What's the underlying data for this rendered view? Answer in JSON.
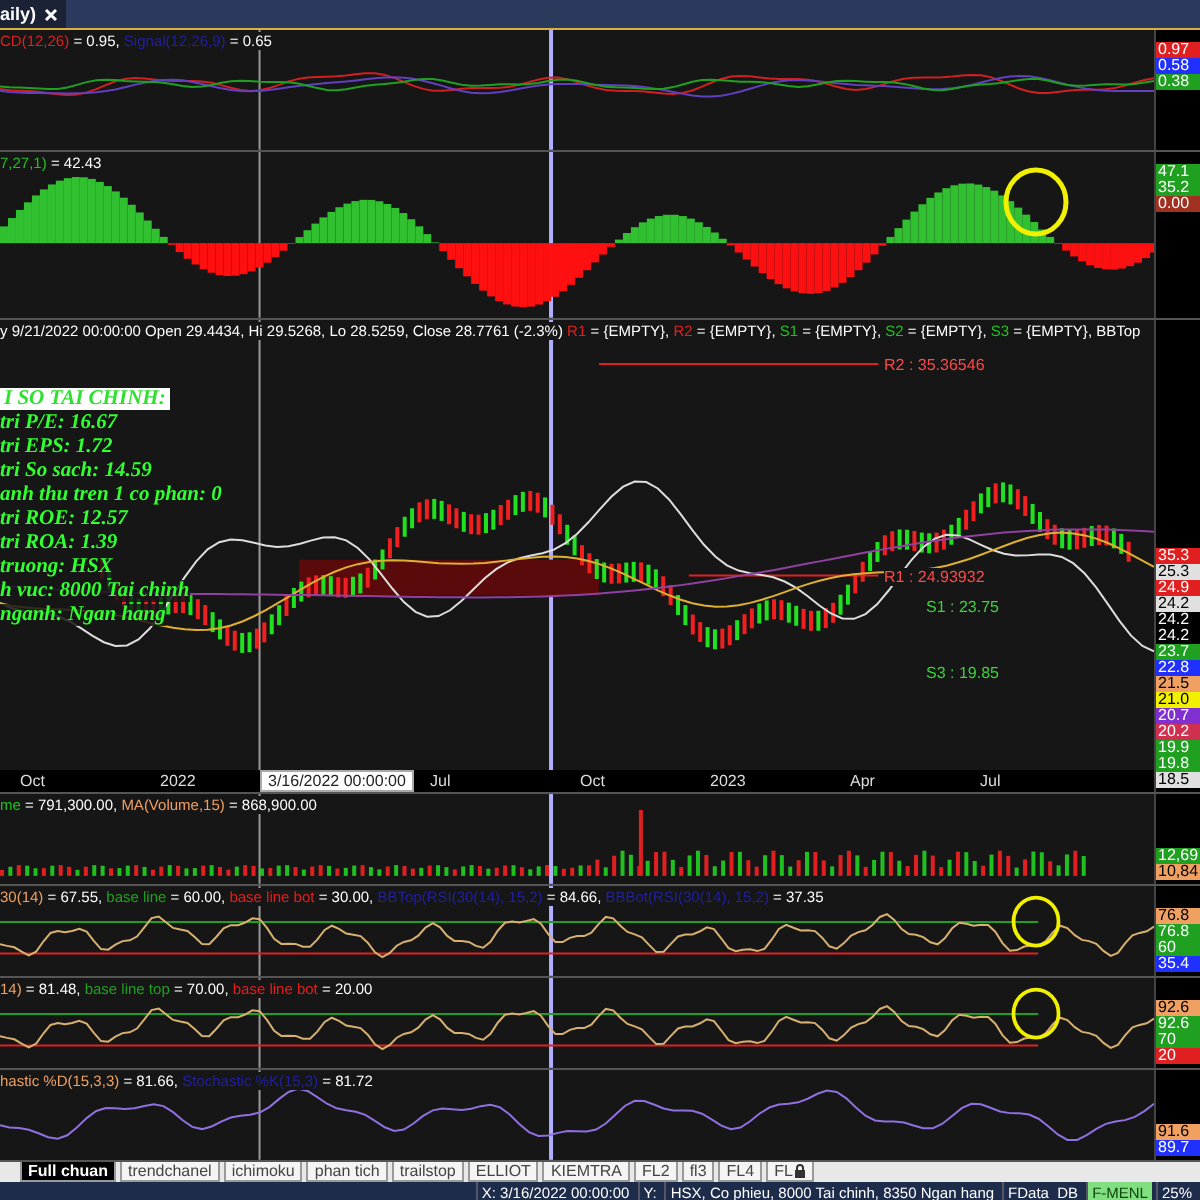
{
  "top_tab": {
    "title": "aily)"
  },
  "panes": [
    {
      "kind": "macd",
      "annotation": false,
      "legend": [
        {
          "text": "CD(12,26)",
          "color": "#e02020"
        },
        {
          "text": " = 0.95, ",
          "color": "#ffffff"
        },
        {
          "text": "Signal(12,26,9)",
          "color": "#2020a0"
        },
        {
          "text": " = 0.65",
          "color": "#ffffff"
        }
      ],
      "axis": [
        {
          "text": "0.97",
          "color": "#e02020"
        },
        {
          "text": "0.58",
          "color": "#2030ff"
        },
        {
          "text": "0.38",
          "color": "#20a020"
        }
      ]
    },
    {
      "kind": "oscillator",
      "annotation": true,
      "legend": [
        {
          "text": "7,27,1)",
          "color": "#20c020"
        },
        {
          "text": " = 42.43",
          "color": "#ffffff"
        }
      ],
      "axis": [
        {
          "text": "47.1",
          "color": "#20a020"
        },
        {
          "text": "35.2",
          "color": "#20a020"
        },
        {
          "text": "0.00",
          "color": "#a03020"
        }
      ]
    },
    {
      "kind": "price",
      "annotation": false,
      "legend": [
        {
          "text": "y 9/21/2022 00:00:00 Open 29.4434, Hi 29.5268, Lo 28.5259, Close 28.7761 (-2.3%) ",
          "color": "#ffffff"
        },
        {
          "text": "R1",
          "color": "#e02020"
        },
        {
          "text": " = {EMPTY}, ",
          "color": "#ffffff"
        },
        {
          "text": "R2",
          "color": "#e02020"
        },
        {
          "text": " = {EMPTY}, ",
          "color": "#ffffff"
        },
        {
          "text": "S1",
          "color": "#20c020"
        },
        {
          "text": " = {EMPTY}, ",
          "color": "#ffffff"
        },
        {
          "text": "S2",
          "color": "#20c020"
        },
        {
          "text": " = {EMPTY}, ",
          "color": "#ffffff"
        },
        {
          "text": "S3",
          "color": "#20c020"
        },
        {
          "text": " = {EMPTY}, BBTop",
          "color": "#ffffff"
        }
      ],
      "axis": [
        {
          "text": "35.3",
          "color": "#e02020"
        },
        {
          "text": "25.3",
          "color": "#e0e0e0"
        },
        {
          "text": "24.9",
          "color": "#e02020"
        },
        {
          "text": "24.2",
          "color": "#e0e0e0"
        },
        {
          "text": "24.2",
          "color": "#000000"
        },
        {
          "text": "24.2",
          "color": "#000000"
        },
        {
          "text": "23.7",
          "color": "#20a020"
        },
        {
          "text": "22.8",
          "color": "#2030ff"
        },
        {
          "text": "21.5",
          "color": "#f0a060"
        },
        {
          "text": "21.0",
          "color": "#f0f000"
        },
        {
          "text": "20.7",
          "color": "#8030d0"
        },
        {
          "text": "20.2",
          "color": "#d03050"
        },
        {
          "text": "19.9",
          "color": "#20a020"
        },
        {
          "text": "19.8",
          "color": "#20a020"
        },
        {
          "text": "18.5",
          "color": "#e0e0e0"
        }
      ],
      "info_title": "I SO TAI CHINH:",
      "info_lines": [
        "tri P/E: 16.67",
        "tri EPS: 1.72",
        "tri So sach: 14.59",
        "anh thu tren 1 co phan: 0",
        "tri ROE: 12.57",
        "tri ROA: 1.39",
        "truong: HSX",
        "h vuc: 8000 Tai chinh",
        "nganh: Ngan hang"
      ],
      "levels": [
        {
          "text": "R2 : 35.36546",
          "kind": "resistance"
        },
        {
          "text": "R1 : 24.93932",
          "kind": "resistance"
        },
        {
          "text": "S1 : 23.75",
          "kind": "support"
        },
        {
          "text": "S3 : 19.85",
          "kind": "support"
        }
      ],
      "dates": [
        "Oct",
        "2022",
        "Jul",
        "Oct",
        "2023",
        "Apr",
        "Jul"
      ],
      "cursor_date": "3/16/2022 00:00:00"
    },
    {
      "kind": "volume",
      "annotation": false,
      "legend": [
        {
          "text": "me",
          "color": "#20c020"
        },
        {
          "text": " = 791,300.00, ",
          "color": "#ffffff"
        },
        {
          "text": "MA(Volume,15)",
          "color": "#f0a060"
        },
        {
          "text": " = 868,900.00",
          "color": "#ffffff"
        }
      ],
      "axis": [
        {
          "text": "12,69",
          "color": "#20a020"
        },
        {
          "text": "10,84",
          "color": "#f0a060"
        }
      ]
    },
    {
      "kind": "rsi",
      "annotation": true,
      "legend": [
        {
          "text": "30(14)",
          "color": "#f0a060"
        },
        {
          "text": " = 67.55, ",
          "color": "#ffffff"
        },
        {
          "text": "base line",
          "color": "#20a020"
        },
        {
          "text": " = 60.00, ",
          "color": "#ffffff"
        },
        {
          "text": "base line bot",
          "color": "#e02020"
        },
        {
          "text": " = 30.00, ",
          "color": "#ffffff"
        },
        {
          "text": "BBTop(RSI(30(14), 15,2)",
          "color": "#2020a0"
        },
        {
          "text": " = 84.66, ",
          "color": "#ffffff"
        },
        {
          "text": "BBBot(RSI(30(14), 15,2)",
          "color": "#2020a0"
        },
        {
          "text": " = 37.35",
          "color": "#ffffff"
        }
      ],
      "axis": [
        {
          "text": "76.8",
          "color": "#f0a060"
        },
        {
          "text": "76.8",
          "color": "#20a020"
        },
        {
          "text": "60",
          "color": "#20a020"
        },
        {
          "text": "35.4",
          "color": "#2030ff"
        }
      ]
    },
    {
      "kind": "rsi",
      "annotation": true,
      "legend": [
        {
          "text": "14)",
          "color": "#f0a060"
        },
        {
          "text": " = 81.48, ",
          "color": "#ffffff"
        },
        {
          "text": "base line top",
          "color": "#20a020"
        },
        {
          "text": " = 70.00, ",
          "color": "#ffffff"
        },
        {
          "text": "base line bot",
          "color": "#e02020"
        },
        {
          "text": " = 20.00",
          "color": "#ffffff"
        }
      ],
      "axis": [
        {
          "text": "92.6",
          "color": "#f0a060"
        },
        {
          "text": "92.6",
          "color": "#20a020"
        },
        {
          "text": "70",
          "color": "#20a020"
        },
        {
          "text": "20",
          "color": "#e02020"
        }
      ]
    },
    {
      "kind": "stochastic",
      "annotation": false,
      "legend": [
        {
          "text": "hastic %D(15,3,3)",
          "color": "#f0a060"
        },
        {
          "text": " = 81.66, ",
          "color": "#ffffff"
        },
        {
          "text": "Stochastic %K(15,3)",
          "color": "#2020a0"
        },
        {
          "text": " = 81.72",
          "color": "#ffffff"
        }
      ],
      "axis": [
        {
          "text": "91.6",
          "color": "#f0a060"
        },
        {
          "text": "89.7",
          "color": "#2030ff"
        }
      ]
    }
  ],
  "sheet_tabs": [
    {
      "label": "Full chuan",
      "selected": true,
      "locked": false
    },
    {
      "label": "trendchanel",
      "selected": false,
      "locked": false
    },
    {
      "label": "ichimoku",
      "selected": false,
      "locked": false
    },
    {
      "label": "phan tich",
      "selected": false,
      "locked": false
    },
    {
      "label": "trailstop",
      "selected": false,
      "locked": false
    },
    {
      "label": "ELLIOT",
      "selected": false,
      "locked": false
    },
    {
      "label": "KIEMTRA",
      "selected": false,
      "locked": false
    },
    {
      "label": "FL2",
      "selected": false,
      "locked": false
    },
    {
      "label": "fl3",
      "selected": false,
      "locked": false
    },
    {
      "label": "FL4",
      "selected": false,
      "locked": false
    },
    {
      "label": "FL",
      "selected": false,
      "locked": true
    }
  ],
  "status_bar": [
    {
      "text": "X: 3/16/2022 00:00:00",
      "highlight": false
    },
    {
      "text": "Y:",
      "highlight": false
    },
    {
      "text": "HSX, Co phieu, 8000 Tai chinh, 8350 Ngan hang",
      "highlight": false
    },
    {
      "text": "FData_DB",
      "highlight": false
    },
    {
      "text": "F-MENL",
      "highlight": true
    },
    {
      "text": "25%",
      "highlight": false
    }
  ]
}
